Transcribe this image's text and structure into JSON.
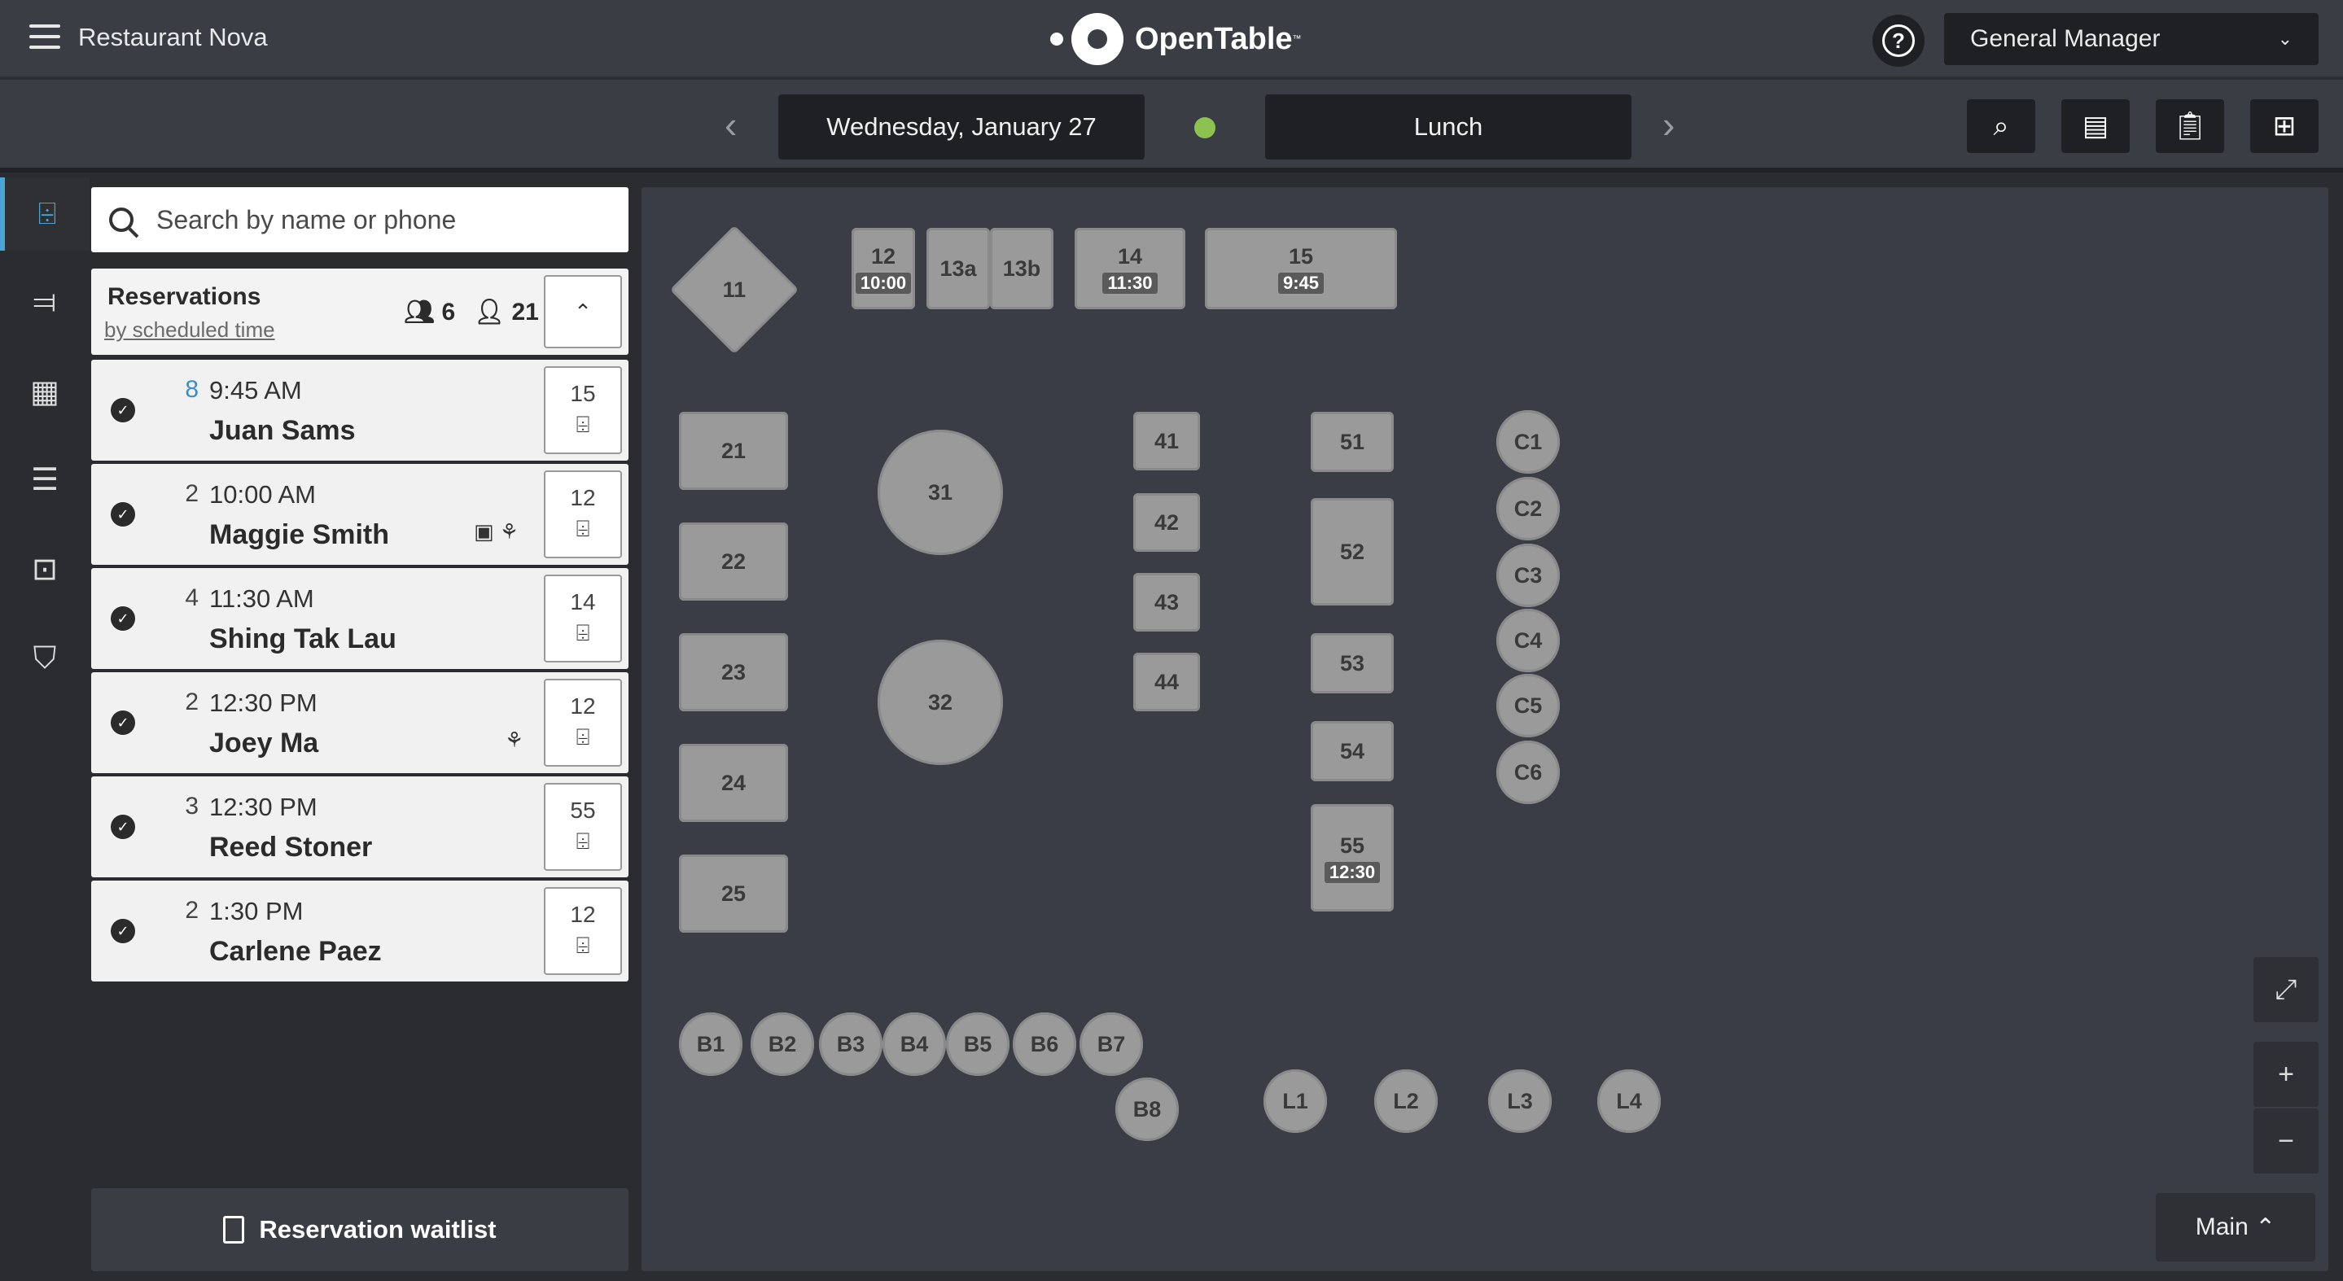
{
  "header": {
    "restaurant_name": "Restaurant Nova",
    "logo_text": "OpenTable",
    "logo_tm": "™",
    "help_label": "?",
    "role": "General Manager"
  },
  "subbar": {
    "date": "Wednesday, January 27",
    "shift": "Lunch",
    "status_color": "#8cc24f"
  },
  "search": {
    "placeholder": "Search by name or phone"
  },
  "reservations": {
    "title": "Reservations",
    "sort": "by scheduled time",
    "party_count": "6",
    "cover_count": "21",
    "items": [
      {
        "party": "8",
        "time": "9:45 AM",
        "name": "Juan Sams",
        "table": "15",
        "highlight": true,
        "icons": ""
      },
      {
        "party": "2",
        "time": "10:00 AM",
        "name": "Maggie Smith",
        "table": "12",
        "icons": "▣ ⚘"
      },
      {
        "party": "4",
        "time": "11:30 AM",
        "name": "Shing Tak Lau",
        "table": "14",
        "icons": ""
      },
      {
        "party": "2",
        "time": "12:30 PM",
        "name": "Joey Ma",
        "table": "12",
        "icons": "⚘"
      },
      {
        "party": "3",
        "time": "12:30 PM",
        "name": "Reed Stoner",
        "table": "55",
        "icons": ""
      },
      {
        "party": "2",
        "time": "1:30 PM",
        "name": "Carlene Paez",
        "table": "12",
        "icons": ""
      }
    ]
  },
  "waitlist_label": "Reservation waitlist",
  "floor": {
    "section": "Main",
    "tables": {
      "t11": "11",
      "t12": "12",
      "t12_time": "10:00",
      "t13a": "13a",
      "t13b": "13b",
      "t14": "14",
      "t14_time": "11:30",
      "t15": "15",
      "t15_time": "9:45",
      "t21": "21",
      "t22": "22",
      "t23": "23",
      "t24": "24",
      "t25": "25",
      "t31": "31",
      "t32": "32",
      "t41": "41",
      "t42": "42",
      "t43": "43",
      "t44": "44",
      "t51": "51",
      "t52": "52",
      "t53": "53",
      "t54": "54",
      "t55": "55",
      "t55_time": "12:30",
      "c1": "C1",
      "c2": "C2",
      "c3": "C3",
      "c4": "C4",
      "c5": "C5",
      "c6": "C6",
      "b1": "B1",
      "b2": "B2",
      "b3": "B3",
      "b4": "B4",
      "b5": "B5",
      "b6": "B6",
      "b7": "B7",
      "b8": "B8",
      "l1": "L1",
      "l2": "L2",
      "l3": "L3",
      "l4": "L4"
    }
  }
}
